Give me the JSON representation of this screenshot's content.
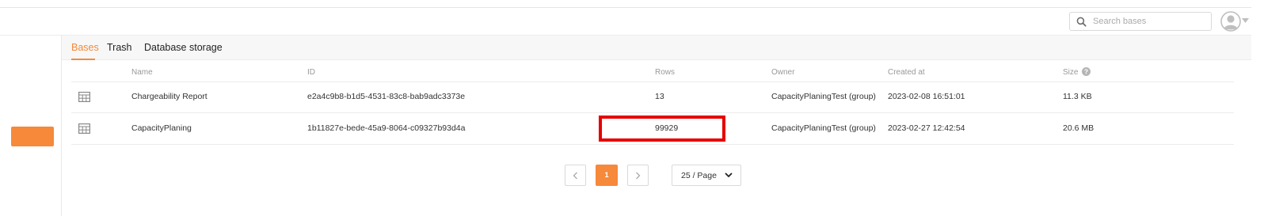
{
  "header": {
    "search": {
      "placeholder": "Search bases",
      "value": ""
    },
    "avatar_icon": "user-circle-icon",
    "caret_icon": "caret-down-icon"
  },
  "tabs": [
    {
      "label": "Bases",
      "active": true
    },
    {
      "label": "Trash",
      "active": false
    },
    {
      "label": "Database storage",
      "active": false
    }
  ],
  "table": {
    "columns": {
      "name": "Name",
      "id": "ID",
      "rows": "Rows",
      "owner": "Owner",
      "created_at": "Created at",
      "size": "Size",
      "size_help_icon": "question-circle-icon"
    },
    "rows": [
      {
        "icon": "table-icon",
        "name": "Chargeability Report",
        "id": "e2a4c9b8-b1d5-4531-83c8-bab9adc3373e",
        "rows": "13",
        "owner": "CapacityPlaningTest (group)",
        "created_at": "2023-02-08 16:51:01",
        "size": "11.3 KB"
      },
      {
        "icon": "table-icon",
        "name": "CapacityPlaning",
        "id": "1b11827e-bede-45a9-8064-c09327b93d4a",
        "rows": "99929",
        "owner": "CapacityPlaningTest (group)",
        "created_at": "2023-02-27 12:42:54",
        "size": "20.6 MB"
      }
    ]
  },
  "pagination": {
    "prev_icon": "chevron-left-icon",
    "next_icon": "chevron-right-icon",
    "current_page": "1",
    "page_size_label": "25 / Page"
  },
  "colors": {
    "accent": "#f6893a",
    "highlight": "#e60000"
  }
}
